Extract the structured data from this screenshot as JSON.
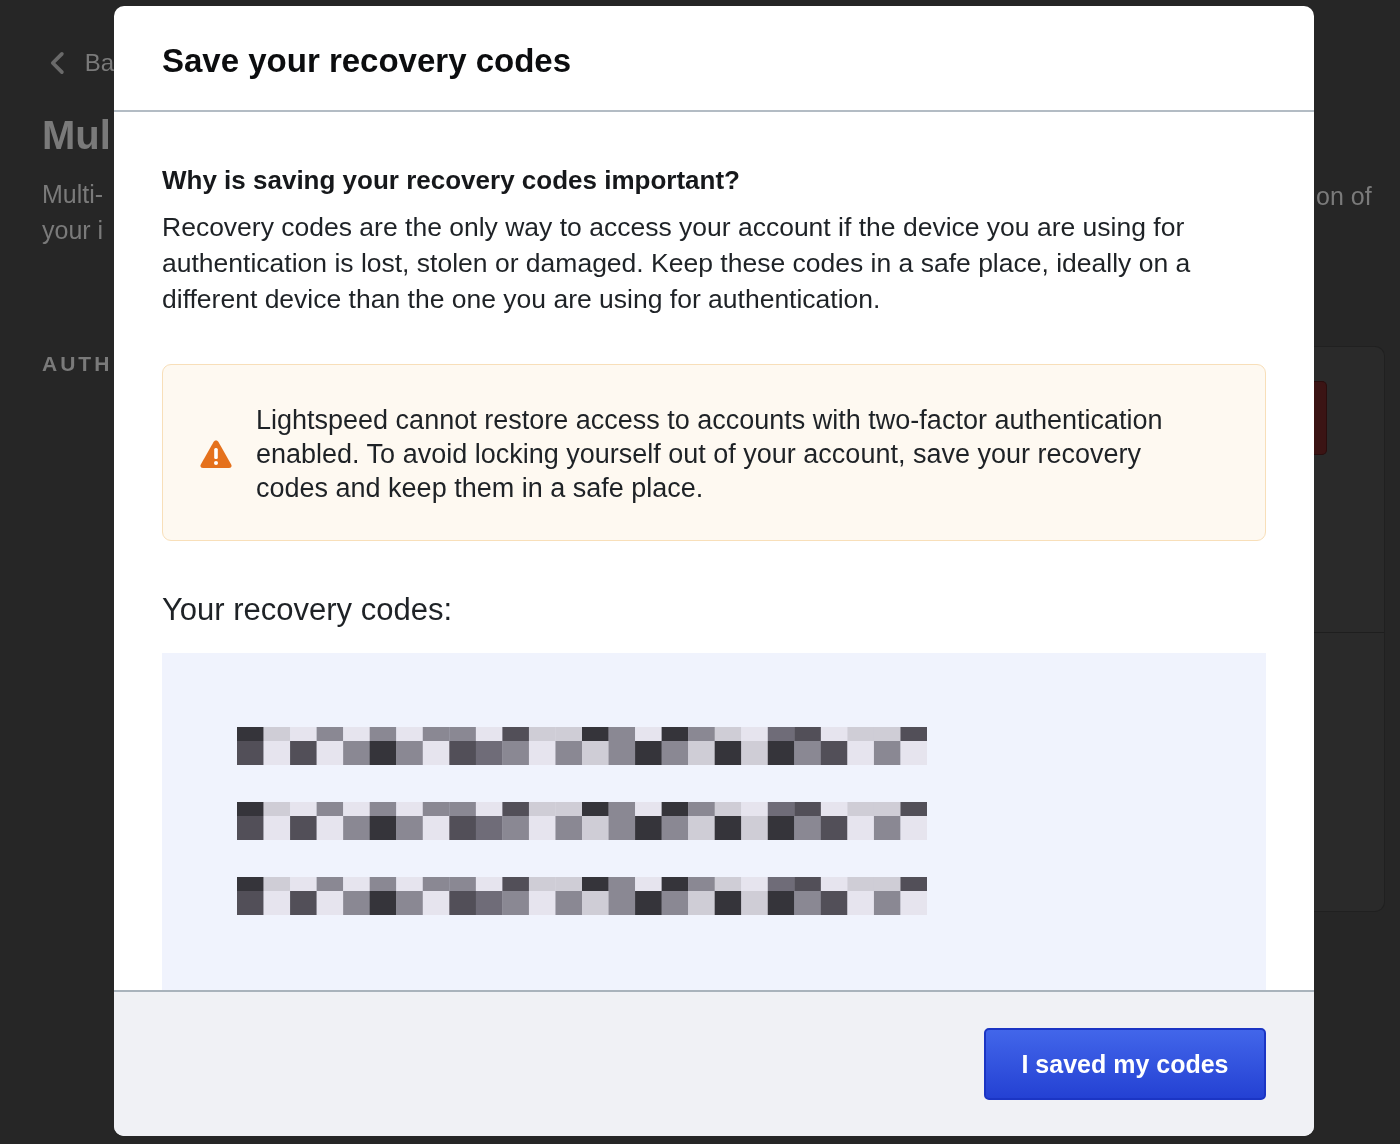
{
  "background_page": {
    "back_link": "Ba",
    "title": "Mul",
    "description_left": [
      "Multi-",
      "your i"
    ],
    "description_right": "on of",
    "section_label": "AUTH"
  },
  "dialog": {
    "title": "Save your recovery codes",
    "heading": "Why is saving your recovery codes important?",
    "body": "Recovery codes are the only way to access your account if the device you are using for authentication is lost, stolen or damaged. Keep these codes in a safe place, ideally on a different device than the one you are using for authentication.",
    "warning": {
      "text": "Lightspeed cannot restore access to accounts with two-factor authentication enabled. To avoid locking yourself out of your account, save your recovery codes and keep them in a safe place."
    },
    "codes_label": "Your recovery codes:",
    "codes": [
      {
        "kind": "pixelated"
      },
      {
        "kind": "pixelated"
      },
      {
        "kind": "pixelated"
      }
    ],
    "confirm_button": "I saved my codes"
  }
}
